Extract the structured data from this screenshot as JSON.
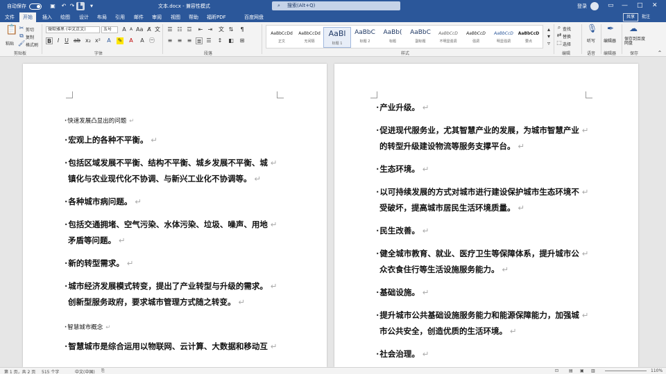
{
  "titlebar": {
    "autosave_label": "自动保存",
    "autosave_state": "关",
    "doc_title": "文本.docx - 兼容性模式",
    "search_placeholder": "搜索(Alt+Q)",
    "user": "登录",
    "win_min": "—",
    "win_max": "□",
    "win_close": "✕"
  },
  "tabs": [
    "文件",
    "开始",
    "插入",
    "绘图",
    "设计",
    "布局",
    "引用",
    "邮件",
    "审阅",
    "视图",
    "帮助",
    "福昕PDF",
    "百度网盘"
  ],
  "active_tab": 1,
  "share_label": "共享",
  "comment_label": "批注",
  "ribbon": {
    "clipboard": {
      "paste": "粘贴",
      "cut": "剪切",
      "copy": "复制",
      "format_painter": "格式刷",
      "label": "剪贴板"
    },
    "font": {
      "family": "微软雅黑 (中文正文)",
      "size": "五号",
      "label": "字体"
    },
    "paragraph": {
      "label": "段落"
    },
    "styles": {
      "label": "样式",
      "items": [
        {
          "preview": "AaBbCcDd",
          "name": "正文"
        },
        {
          "preview": "AaBbCcDd",
          "name": "无间隔"
        },
        {
          "preview": "AaBl",
          "name": "标题 1"
        },
        {
          "preview": "AaBbC",
          "name": "标题 2"
        },
        {
          "preview": "AaBb(",
          "name": "标题"
        },
        {
          "preview": "AaBbC",
          "name": "副标题"
        },
        {
          "preview": "AaBbCcD",
          "name": "不明显强调"
        },
        {
          "preview": "AaBbCcD",
          "name": "强调"
        },
        {
          "preview": "AaBbCcD",
          "name": "明显强调"
        },
        {
          "preview": "AaBbCcD",
          "name": "要点"
        }
      ]
    },
    "editing": {
      "find": "查找",
      "replace": "替换",
      "select": "选择",
      "label": "编辑"
    },
    "voice": {
      "dictate": "听写",
      "label": "语音"
    },
    "editor": {
      "name": "编辑器",
      "label": "编辑器"
    },
    "save": {
      "name": "保存到百度网盘",
      "label": "保存"
    }
  },
  "document": {
    "page1": [
      {
        "text": "快速发展凸显出的问题",
        "style": "small"
      },
      {
        "text": "宏观上的各种不平衡。",
        "style": "bold"
      },
      {
        "text": "包括区域发展不平衡、结构不平衡、城乡发展不平衡、城",
        "style": "bold"
      },
      {
        "text": "镇化与农业现代化不协调、与新兴工业化不协调等。",
        "style": "bold",
        "cont": true
      },
      {
        "text": "各种城市病问题。",
        "style": "bold"
      },
      {
        "text": "包括交通拥堵、空气污染、水体污染、垃圾、噪声、用地",
        "style": "bold"
      },
      {
        "text": "矛盾等问题。",
        "style": "bold",
        "cont": true
      },
      {
        "text": "新的转型需求。",
        "style": "bold"
      },
      {
        "text": "城市经济发展模式转变，提出了产业转型与升级的需求。",
        "style": "bold"
      },
      {
        "text": "创新型服务政府，要求城市管理方式随之转变。",
        "style": "bold",
        "cont": true
      },
      {
        "text": "智慧城市概念",
        "style": "small"
      },
      {
        "text": "智慧城市是综合运用以物联网、云计算、大数据和移动互",
        "style": "bold"
      }
    ],
    "page2": [
      {
        "text": "产业升级。",
        "style": "bold"
      },
      {
        "text": "促进现代服务业，尤其智慧产业的发展，为城市智慧产业",
        "style": "bold"
      },
      {
        "text": "的转型升级建设物流等服务支撑平台。",
        "style": "bold",
        "cont": true
      },
      {
        "text": "生态环境。",
        "style": "bold"
      },
      {
        "text": "以可持续发展的方式对城市进行建设保护城市生态环境不",
        "style": "bold"
      },
      {
        "text": "受破坏，提高城市居民生活环境质量。",
        "style": "bold",
        "cont": true
      },
      {
        "text": "民生改善。",
        "style": "bold"
      },
      {
        "text": "健全城市教育、就业、医疗卫生等保障体系，提升城市公",
        "style": "bold"
      },
      {
        "text": "众衣食住行等生活设施服务能力。",
        "style": "bold",
        "cont": true
      },
      {
        "text": "基础设施。",
        "style": "bold"
      },
      {
        "text": "提升城市公共基础设施服务能力和能源保障能力，加强城",
        "style": "bold"
      },
      {
        "text": "市公共安全，创造优质的生活环境。",
        "style": "bold",
        "cont": true
      },
      {
        "text": "社会治理。",
        "style": "bold"
      }
    ],
    "para_mark": "↵",
    "bullet": "·"
  },
  "statusbar": {
    "page": "第 1 页，共 2 页",
    "words": "515 个字",
    "lang": "中文(中国)",
    "zoom": "110%"
  }
}
